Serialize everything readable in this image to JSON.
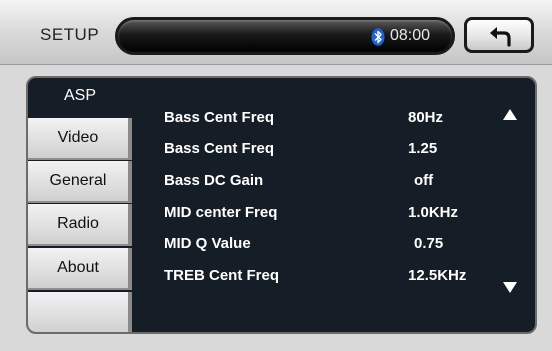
{
  "header": {
    "title": "SETUP",
    "clock": "08:00",
    "bluetooth_icon": "bluetooth-icon",
    "back_icon": "back-arrow-icon"
  },
  "tabs": [
    {
      "label": "ASP",
      "active": true
    },
    {
      "label": "Video",
      "active": false
    },
    {
      "label": "General",
      "active": false
    },
    {
      "label": "Radio",
      "active": false
    },
    {
      "label": "About",
      "active": false
    }
  ],
  "settings": [
    {
      "label": "Bass Cent Freq",
      "value": "80Hz"
    },
    {
      "label": "Bass Cent Freq",
      "value": "1.25"
    },
    {
      "label": "Bass DC Gain",
      "value": "off"
    },
    {
      "label": "MID center Freq",
      "value": "1.0KHz"
    },
    {
      "label": "MID Q Value",
      "value": "0.75"
    },
    {
      "label": "TREB Cent Freq",
      "value": "12.5KHz"
    }
  ],
  "scroll": {
    "up_icon": "arrow-up-icon",
    "down_icon": "arrow-down-icon"
  },
  "colors": {
    "panel_background": "#151d27",
    "text_on_panel": "#ffffff",
    "tab_background": "#dedede"
  }
}
